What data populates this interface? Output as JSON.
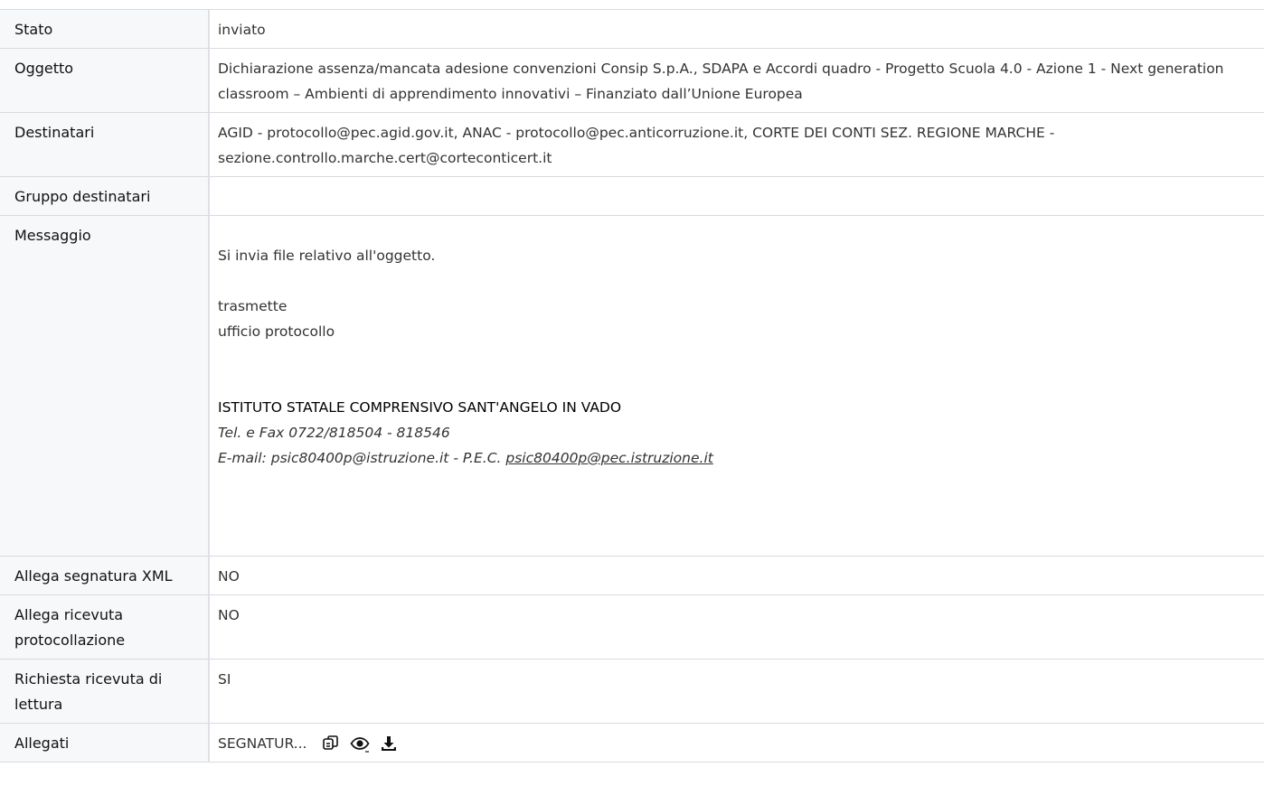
{
  "rows": {
    "stato": {
      "label": "Stato",
      "value": "inviato"
    },
    "oggetto": {
      "label": "Oggetto",
      "value": "Dichiarazione assenza/mancata adesione convenzioni Consip S.p.A., SDAPA e Accordi quadro - Progetto Scuola 4.0 - Azione 1 - Next generation classroom – Ambienti di apprendimento innovativi – Finanziato dall’Unione Europea"
    },
    "destinatari": {
      "label": "Destinatari",
      "value": "AGID - protocollo@pec.agid.gov.it, ANAC - protocollo@pec.anticorruzione.it, CORTE DEI CONTI SEZ. REGIONE MARCHE - sezione.controllo.marche.cert@corteconticert.it"
    },
    "gruppo": {
      "label": "Gruppo destinatari",
      "value": ""
    },
    "messaggio": {
      "label": "Messaggio",
      "line1": "Si invia file relativo all'oggetto.",
      "line2": "trasmette",
      "line3": "ufficio protocollo",
      "school": "ISTITUTO STATALE COMPRENSIVO SANT'ANGELO IN VADO",
      "tel": "Tel. e Fax 0722/818504 - 818546",
      "email_prefix": "E-mail: psic80400p@istruzione.it - P.E.C. ",
      "pec_link": "psic80400p@pec.istruzione.it"
    },
    "segnatura": {
      "label": "Allega segnatura XML",
      "value": "NO"
    },
    "ricevuta_prot": {
      "label": "Allega ricevuta protocollazione",
      "value": "NO"
    },
    "ricevuta_lettura": {
      "label": "Richiesta ricevuta di lettura",
      "value": "SI"
    },
    "allegati": {
      "label": "Allegati",
      "filename": "SEGNATUR...",
      "icons": [
        "copy-icon",
        "eye-icon",
        "download-icon"
      ]
    }
  }
}
